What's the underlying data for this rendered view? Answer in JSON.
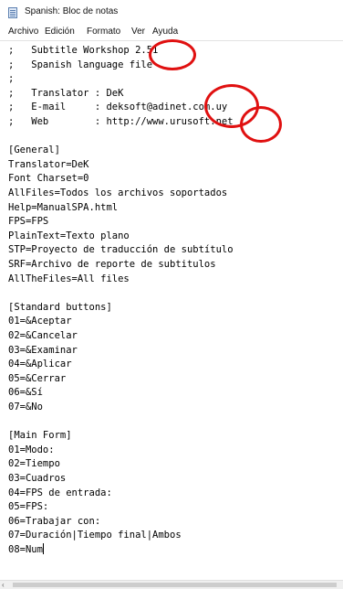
{
  "window": {
    "title": "Spanish: Bloc de notas",
    "icon": "notepad-icon"
  },
  "menu": [
    "Archivo",
    "Edición",
    "Formato",
    "Ver",
    "Ayuda"
  ],
  "editor": {
    "lines": [
      ";   Subtitle Workshop 2.51",
      ";   Spanish language file",
      ";",
      ";   Translator : DeK",
      ";   E-mail     : deksoft@adinet.com.uy",
      ";   Web        : http://www.urusoft.net",
      "",
      "[General]",
      "Translator=DeK",
      "Font Charset=0",
      "AllFiles=Todos los archivos soportados",
      "Help=ManualSPA.html",
      "FPS=FPS",
      "PlainText=Texto plano",
      "STP=Proyecto de traducción de subtítulo",
      "SRF=Archivo de reporte de subtitulos",
      "AllTheFiles=All files",
      "",
      "[Standard buttons]",
      "01=&Aceptar",
      "02=&Cancelar",
      "03=&Examinar",
      "04=&Aplicar",
      "05=&Cerrar",
      "06=&Sí",
      "07=&No",
      "",
      "[Main Form]",
      "01=Modo:",
      "02=Tiempo",
      "03=Cuadros",
      "04=FPS de entrada:",
      "05=FPS:",
      "06=Trabajar con:",
      "07=Duración|Tiempo final|Ambos",
      "08=Num"
    ]
  },
  "annotations": {
    "color": "#e01010"
  },
  "scrollbar": {
    "left_arrow": "‹"
  }
}
